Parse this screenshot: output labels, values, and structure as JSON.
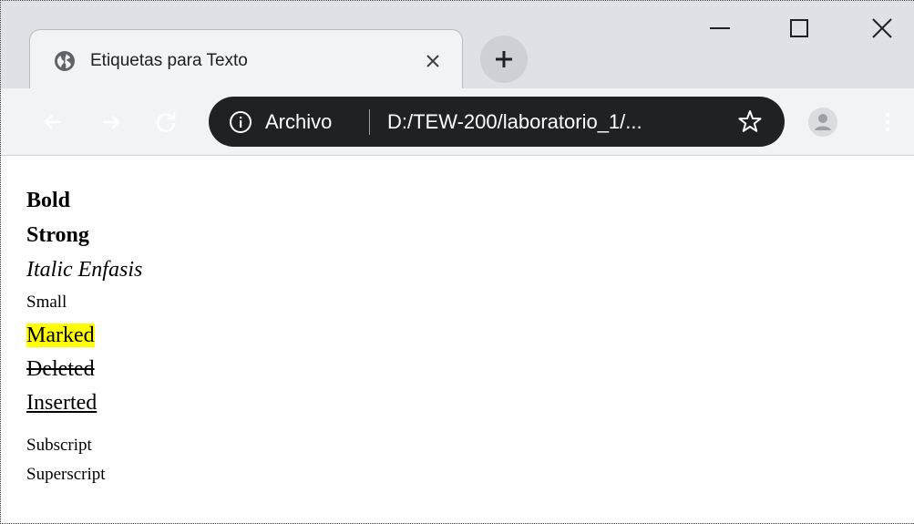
{
  "browser": {
    "tab": {
      "title": "Etiquetas para Texto",
      "favicon": "globe-icon"
    },
    "new_tab_icon": "plus-icon",
    "window_controls": [
      "minimize-icon",
      "maximize-icon",
      "close-icon"
    ],
    "address_bar": {
      "origin_label": "Archivo",
      "url": "D:/TEW-200/laboratorio_1/...",
      "info_icon": "info-icon",
      "bookmark_icon": "star-icon"
    },
    "colors": {
      "titlebar": "#dee1e6",
      "toolbar": "#f1f3f4",
      "omnibox": "#202124",
      "highlight": "#ffff00"
    }
  },
  "page": {
    "lines": {
      "bold": "Bold",
      "strong": "Strong",
      "italic_emphasis": "Italic Enfasis",
      "small": "Small",
      "marked": "Marked",
      "deleted": "Deleted",
      "inserted": "Inserted",
      "subscript": "Subscript",
      "superscript": "Superscript"
    }
  }
}
